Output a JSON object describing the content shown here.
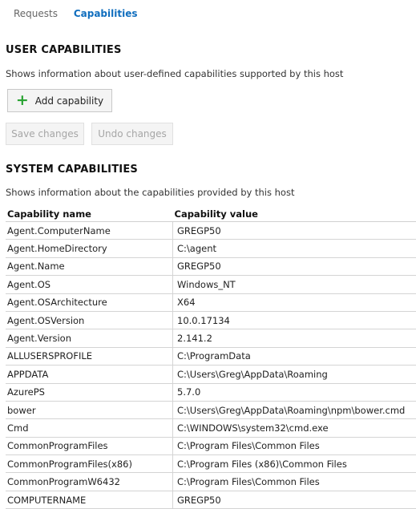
{
  "tabs": [
    {
      "label": "Requests",
      "active": false
    },
    {
      "label": "Capabilities",
      "active": true
    }
  ],
  "user": {
    "title": "USER CAPABILITIES",
    "description": "Shows information about user-defined capabilities supported by this host",
    "add_label": "Add capability",
    "save_label": "Save changes",
    "undo_label": "Undo changes"
  },
  "system": {
    "title": "SYSTEM CAPABILITIES",
    "description": "Shows information about the capabilities provided by this host",
    "columns": [
      "Capability name",
      "Capability value"
    ],
    "rows": [
      {
        "name": "Agent.ComputerName",
        "value": "GREGP50"
      },
      {
        "name": "Agent.HomeDirectory",
        "value": "C:\\agent"
      },
      {
        "name": "Agent.Name",
        "value": "GREGP50"
      },
      {
        "name": "Agent.OS",
        "value": "Windows_NT"
      },
      {
        "name": "Agent.OSArchitecture",
        "value": "X64"
      },
      {
        "name": "Agent.OSVersion",
        "value": "10.0.17134"
      },
      {
        "name": "Agent.Version",
        "value": "2.141.2"
      },
      {
        "name": "ALLUSERSPROFILE",
        "value": "C:\\ProgramData"
      },
      {
        "name": "APPDATA",
        "value": "C:\\Users\\Greg\\AppData\\Roaming"
      },
      {
        "name": "AzurePS",
        "value": "5.7.0"
      },
      {
        "name": "bower",
        "value": "C:\\Users\\Greg\\AppData\\Roaming\\npm\\bower.cmd"
      },
      {
        "name": "Cmd",
        "value": "C:\\WINDOWS\\system32\\cmd.exe"
      },
      {
        "name": "CommonProgramFiles",
        "value": "C:\\Program Files\\Common Files"
      },
      {
        "name": "CommonProgramFiles(x86)",
        "value": "C:\\Program Files (x86)\\Common Files"
      },
      {
        "name": "CommonProgramW6432",
        "value": "C:\\Program Files\\Common Files"
      },
      {
        "name": "COMPUTERNAME",
        "value": "GREGP50"
      }
    ]
  }
}
